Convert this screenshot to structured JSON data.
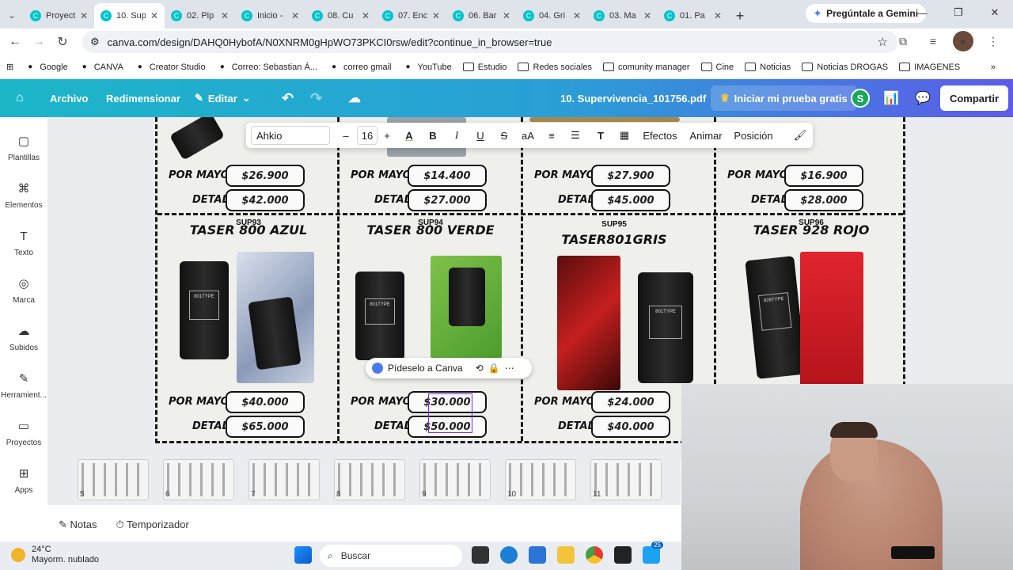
{
  "browser": {
    "tabs": [
      {
        "label": "Proyect",
        "active": false
      },
      {
        "label": "10. Sup",
        "active": true
      },
      {
        "label": "02. Pip",
        "active": false
      },
      {
        "label": "Inicio -",
        "active": false
      },
      {
        "label": "08. Cu",
        "active": false
      },
      {
        "label": "07. Enc",
        "active": false
      },
      {
        "label": "06. Bar",
        "active": false
      },
      {
        "label": "04. Gri",
        "active": false
      },
      {
        "label": "03. Ma",
        "active": false
      },
      {
        "label": "01. Pa",
        "active": false
      }
    ],
    "gemini_label": "Pregúntale a Gemini",
    "url": "canva.com/design/DAHQ0HybofA/N0XNRM0gHpWO73PKCI0rsw/edit?continue_in_browser=true",
    "bookmarks": [
      "Google",
      "CANVA",
      "Creator Studio",
      "Correo: Sebastian Á...",
      "correo gmail",
      "YouTube",
      "Estudio",
      "Redes sociales",
      "comunity manager",
      "Cine",
      "Noticias",
      "Noticias DROGAS",
      "IMAGENES"
    ]
  },
  "canva": {
    "menu": {
      "archivo": "Archivo",
      "redimensionar": "Redimensionar",
      "editar": "Editar"
    },
    "doc_title": "10. Supervivencia_101756.pdf",
    "trial": "Iniciar mi prueba gratis",
    "avatar_letter": "S",
    "share": "Compartir",
    "rail": [
      {
        "label": "Plantillas",
        "icon": "template-icon"
      },
      {
        "label": "Elementos",
        "icon": "elements-icon"
      },
      {
        "label": "Texto",
        "icon": "text-icon"
      },
      {
        "label": "Marca",
        "icon": "brand-icon"
      },
      {
        "label": "Subidos",
        "icon": "upload-icon"
      },
      {
        "label": "Herramient...",
        "icon": "tools-icon"
      },
      {
        "label": "Proyectos",
        "icon": "folder-icon"
      },
      {
        "label": "Apps",
        "icon": "apps-icon"
      }
    ],
    "toolbar": {
      "font": "Ahkio",
      "size": "16",
      "effects": "Efectos",
      "animate": "Animar",
      "position": "Posición"
    },
    "ask_canva": "Pídeselo a Canva",
    "labels": {
      "mayor": "POR MAYOR",
      "detal": "DETAL"
    },
    "top_row": [
      {
        "mayor": "$26.900",
        "detal": "$42.000"
      },
      {
        "mayor": "$14.400",
        "detal": "$27.000"
      },
      {
        "mayor": "$27.900",
        "detal": "$45.000"
      },
      {
        "mayor": "$16.900",
        "detal": "$28.000"
      }
    ],
    "products": [
      {
        "code": "SUP93",
        "title": "TASER 800 AZUL",
        "mayor": "$40.000",
        "detal": "$65.000"
      },
      {
        "code": "SUP94",
        "title": "TASER 800 VERDE",
        "mayor": "$30.000",
        "detal": "$50.000"
      },
      {
        "code": "SUP95",
        "title": "TASER801GRIS",
        "mayor": "$24.000",
        "detal": "$40.000"
      },
      {
        "code": "SUP96",
        "title": "TASER 928 ROJO",
        "mayor": "",
        "detal": ""
      }
    ],
    "thumb_numbers": [
      "5",
      "6",
      "7",
      "8",
      "9",
      "10",
      "11"
    ],
    "notes": "Notas",
    "timer": "Temporizador"
  },
  "taskbar": {
    "temp": "24°C",
    "weather": "Mayorm. nublado",
    "search": "Buscar",
    "badge": "25"
  }
}
